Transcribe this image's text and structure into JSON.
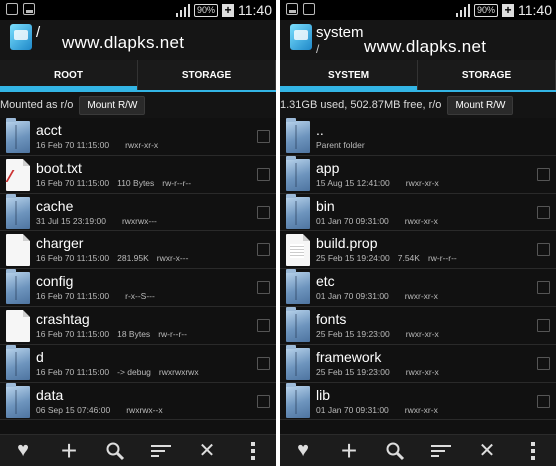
{
  "watermark": "www.dlapks.net",
  "left": {
    "status": {
      "battery": "90%",
      "time": "11:40"
    },
    "title": "/",
    "subtitle": "",
    "tabs": [
      "ROOT",
      "STORAGE"
    ],
    "info": "Mounted as r/o",
    "mount_label": "Mount R/W",
    "rows": [
      {
        "name": "acct",
        "kind": "folder",
        "date": "16 Feb 70 11:15:00",
        "size": "",
        "perms": "rwxr-xr-x"
      },
      {
        "name": "boot.txt",
        "kind": "file-red",
        "date": "16 Feb 70 11:15:00",
        "size": "110 Bytes",
        "perms": "rw-r--r--"
      },
      {
        "name": "cache",
        "kind": "folder",
        "date": "31 Jul 15 23:19:00",
        "size": "",
        "perms": "rwxrwx---"
      },
      {
        "name": "charger",
        "kind": "file",
        "date": "16 Feb 70 11:15:00",
        "size": "281.95K",
        "perms": "rwxr-x---"
      },
      {
        "name": "config",
        "kind": "folder",
        "date": "16 Feb 70 11:15:00",
        "size": "",
        "perms": "r-x--S---"
      },
      {
        "name": "crashtag",
        "kind": "file",
        "date": "16 Feb 70 11:15:00",
        "size": "18 Bytes",
        "perms": "rw-r--r--"
      },
      {
        "name": "d",
        "kind": "folder",
        "date": "16 Feb 70 11:15:00",
        "size": "-> debug",
        "perms": "rwxrwxrwx"
      },
      {
        "name": "data",
        "kind": "folder",
        "date": "06 Sep 15 07:46:00",
        "size": "",
        "perms": "rwxrwx--x"
      }
    ]
  },
  "right": {
    "status": {
      "battery": "90%",
      "time": "11:40"
    },
    "title": "system",
    "subtitle": "/",
    "tabs": [
      "SYSTEM",
      "STORAGE"
    ],
    "info": "1.31GB used, 502.87MB free, r/o",
    "mount_label": "Mount R/W",
    "rows": [
      {
        "name": "..",
        "kind": "folder",
        "date": "Parent folder",
        "size": "",
        "perms": ""
      },
      {
        "name": "app",
        "kind": "folder",
        "date": "15 Aug 15 12:41:00",
        "size": "",
        "perms": "rwxr-xr-x"
      },
      {
        "name": "bin",
        "kind": "folder",
        "date": "01 Jan 70 09:31:00",
        "size": "",
        "perms": "rwxr-xr-x"
      },
      {
        "name": "build.prop",
        "kind": "file-txt",
        "date": "25 Feb 15 19:24:00",
        "size": "7.54K",
        "perms": "rw-r--r--"
      },
      {
        "name": "etc",
        "kind": "folder",
        "date": "01 Jan 70 09:31:00",
        "size": "",
        "perms": "rwxr-xr-x"
      },
      {
        "name": "fonts",
        "kind": "folder",
        "date": "25 Feb 15 19:23:00",
        "size": "",
        "perms": "rwxr-xr-x"
      },
      {
        "name": "framework",
        "kind": "folder",
        "date": "25 Feb 15 19:23:00",
        "size": "",
        "perms": "rwxr-xr-x"
      },
      {
        "name": "lib",
        "kind": "folder",
        "date": "01 Jan 70 09:31:00",
        "size": "",
        "perms": "rwxr-xr-x"
      }
    ]
  },
  "bottom_icons": [
    "heart-icon",
    "plus-icon",
    "search-icon",
    "sort-icon",
    "close-icon",
    "more-icon"
  ]
}
